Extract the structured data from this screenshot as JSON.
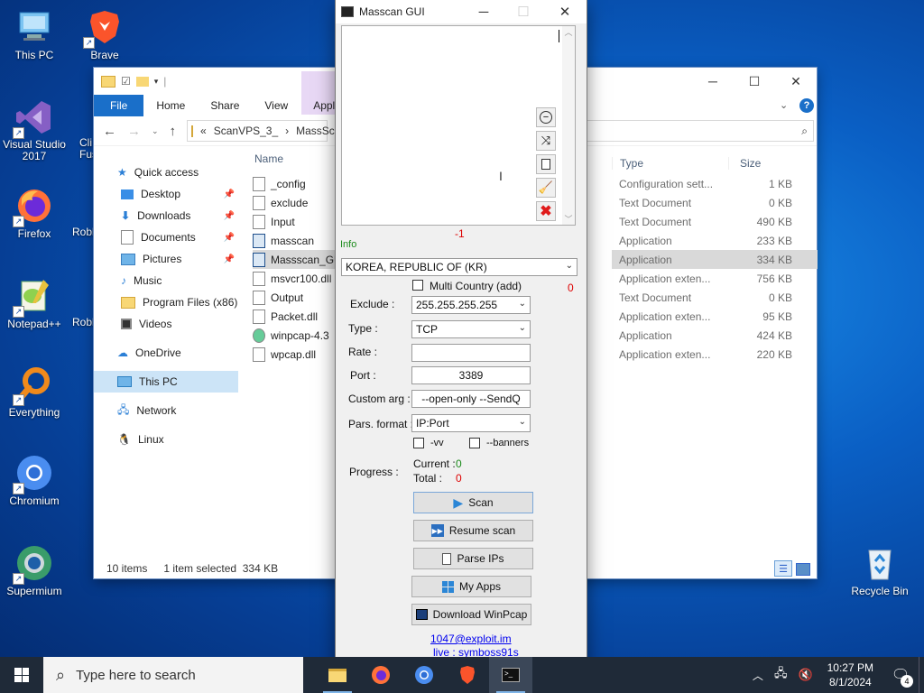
{
  "desktop_icons": [
    {
      "label": "This PC",
      "icon": "this-pc-icon"
    },
    {
      "label": "Brave",
      "icon": "brave-icon"
    },
    {
      "label": "Visual Studio 2017",
      "icon": "visual-studio-icon"
    },
    {
      "label": "Firefox",
      "icon": "firefox-icon"
    },
    {
      "label": "Notepad++",
      "icon": "notepadpp-icon"
    },
    {
      "label": "Everything",
      "icon": "everything-icon"
    },
    {
      "label": "Chromium",
      "icon": "chromium-icon"
    },
    {
      "label": "Supermium",
      "icon": "supermium-icon"
    },
    {
      "label": "Recycle Bin",
      "icon": "recycle-bin-icon"
    },
    {
      "label": "Cli Fus",
      "icon": "partial-icon"
    },
    {
      "label": "Robl",
      "icon": "partial-icon"
    },
    {
      "label": "Robl",
      "icon": "partial-icon"
    }
  ],
  "explorer": {
    "ribbon_tabs": [
      "File",
      "Home",
      "Share",
      "View",
      "Appl"
    ],
    "address": {
      "prefix": "«",
      "crumb1": "ScanVPS_3_",
      "crumb2": "MassSc"
    },
    "nav": [
      {
        "label": "Quick access",
        "icon": "star-icon"
      },
      {
        "label": "Desktop",
        "icon": "desktop-folder-icon",
        "pinned": true
      },
      {
        "label": "Downloads",
        "icon": "downloads-icon",
        "pinned": true
      },
      {
        "label": "Documents",
        "icon": "documents-icon",
        "pinned": true
      },
      {
        "label": "Pictures",
        "icon": "pictures-icon",
        "pinned": true
      },
      {
        "label": "Music",
        "icon": "music-icon"
      },
      {
        "label": "Program Files (x86)",
        "icon": "folder-icon"
      },
      {
        "label": "Videos",
        "icon": "videos-icon"
      },
      {
        "label": "OneDrive",
        "icon": "onedrive-icon"
      },
      {
        "label": "This PC",
        "icon": "this-pc-icon"
      },
      {
        "label": "Network",
        "icon": "network-icon"
      },
      {
        "label": "Linux",
        "icon": "linux-icon"
      }
    ],
    "columns": {
      "name": "Name",
      "type": "Type",
      "size": "Size"
    },
    "files": [
      {
        "name": "_config",
        "type": "Configuration sett...",
        "size": "1 KB"
      },
      {
        "name": "exclude",
        "type": "Text Document",
        "size": "0 KB"
      },
      {
        "name": "Input",
        "type": "Text Document",
        "size": "490 KB"
      },
      {
        "name": "masscan",
        "type": "Application",
        "size": "233 KB"
      },
      {
        "name": "Massscan_GU",
        "type": "Application",
        "size": "334 KB",
        "selected": true
      },
      {
        "name": "msvcr100.dll",
        "type": "Application exten...",
        "size": "756 KB"
      },
      {
        "name": "Output",
        "type": "Text Document",
        "size": "0 KB"
      },
      {
        "name": "Packet.dll",
        "type": "Application exten...",
        "size": "95 KB"
      },
      {
        "name": "winpcap-4.3",
        "type": "Application",
        "size": "424 KB"
      },
      {
        "name": "wpcap.dll",
        "type": "Application exten...",
        "size": "220 KB"
      }
    ],
    "status": {
      "items": "10 items",
      "selected": "1 item selected",
      "size": "334 KB"
    }
  },
  "masscan": {
    "title": "Masscan GUI",
    "counter": "-1",
    "info_label": "Info",
    "country": "KOREA, REPUBLIC OF (KR)",
    "multi_country_label": "Multi Country (add)",
    "multi_country_count": "0",
    "exclude_label": "Exclude :",
    "exclude_value": "255.255.255.255",
    "type_label": "Type :",
    "type_value": "TCP",
    "rate_label": "Rate :",
    "rate_value": "",
    "port_label": "Port :",
    "port_value": "3389",
    "custom_arg_label": "Custom arg :",
    "custom_arg_value": "--open-only --SendQ",
    "pars_format_label": "Pars. format :",
    "pars_format_value": "IP:Port",
    "vv_label": "-vv",
    "banners_label": "--banners",
    "progress_label": "Progress :",
    "current_label": "Current :",
    "current_value": "0",
    "total_label": "Total :",
    "total_value": "0",
    "buttons": {
      "scan": "Scan",
      "resume": "Resume scan",
      "parse": "Parse IPs",
      "myapps": "My Apps",
      "winpcap": "Download WinPcap"
    },
    "link1": "1047@exploit.im",
    "link2": "live : symboss91s",
    "link3": "..."
  },
  "taskbar": {
    "search_placeholder": "Type here to search",
    "time": "10:27 PM",
    "date": "8/1/2024",
    "notification_count": "4"
  }
}
